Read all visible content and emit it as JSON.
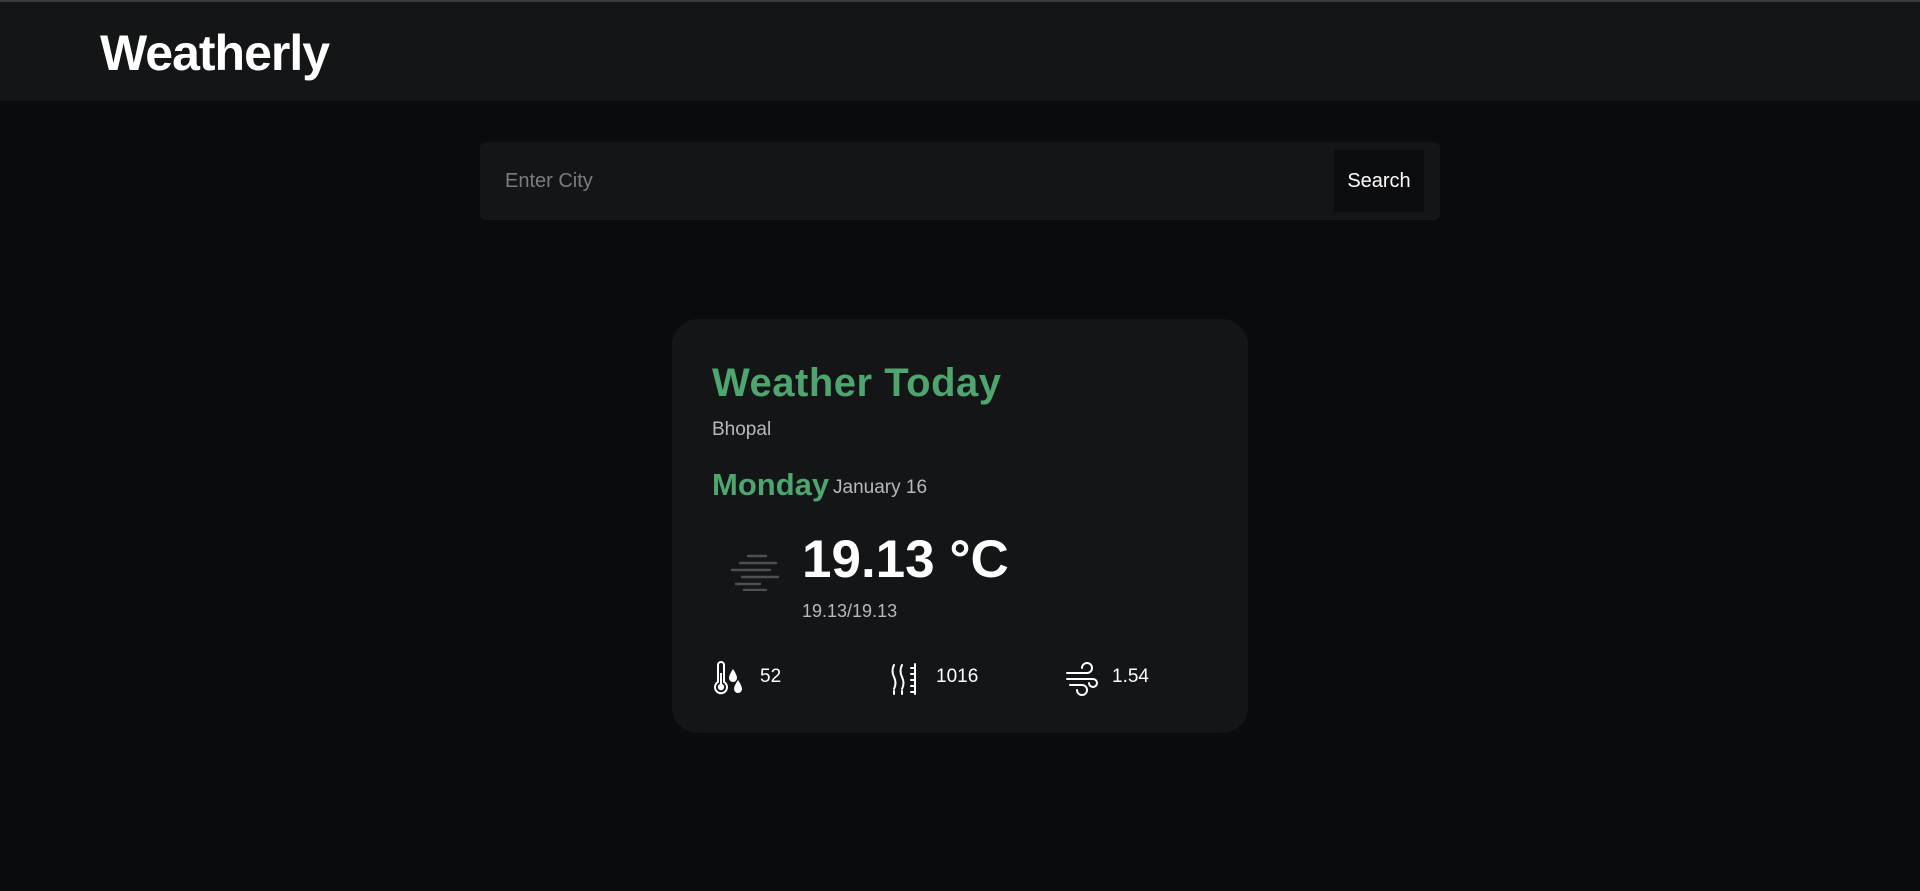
{
  "app": {
    "title": "Weatherly"
  },
  "search": {
    "placeholder": "Enter City",
    "value": "",
    "button_label": "Search"
  },
  "weather": {
    "heading": "Weather Today",
    "city": "Bhopal",
    "day": "Monday",
    "date": "January 16",
    "temperature": "19.13 °C",
    "min_max": "19.13/19.13",
    "condition_icon": "mist-icon",
    "humidity": "52",
    "pressure": "1016",
    "wind": "1.54"
  },
  "colors": {
    "background": "#0a0b0d",
    "panel": "#141517",
    "accent": "#4ea56f",
    "muted_text": "#b7b9bd"
  }
}
